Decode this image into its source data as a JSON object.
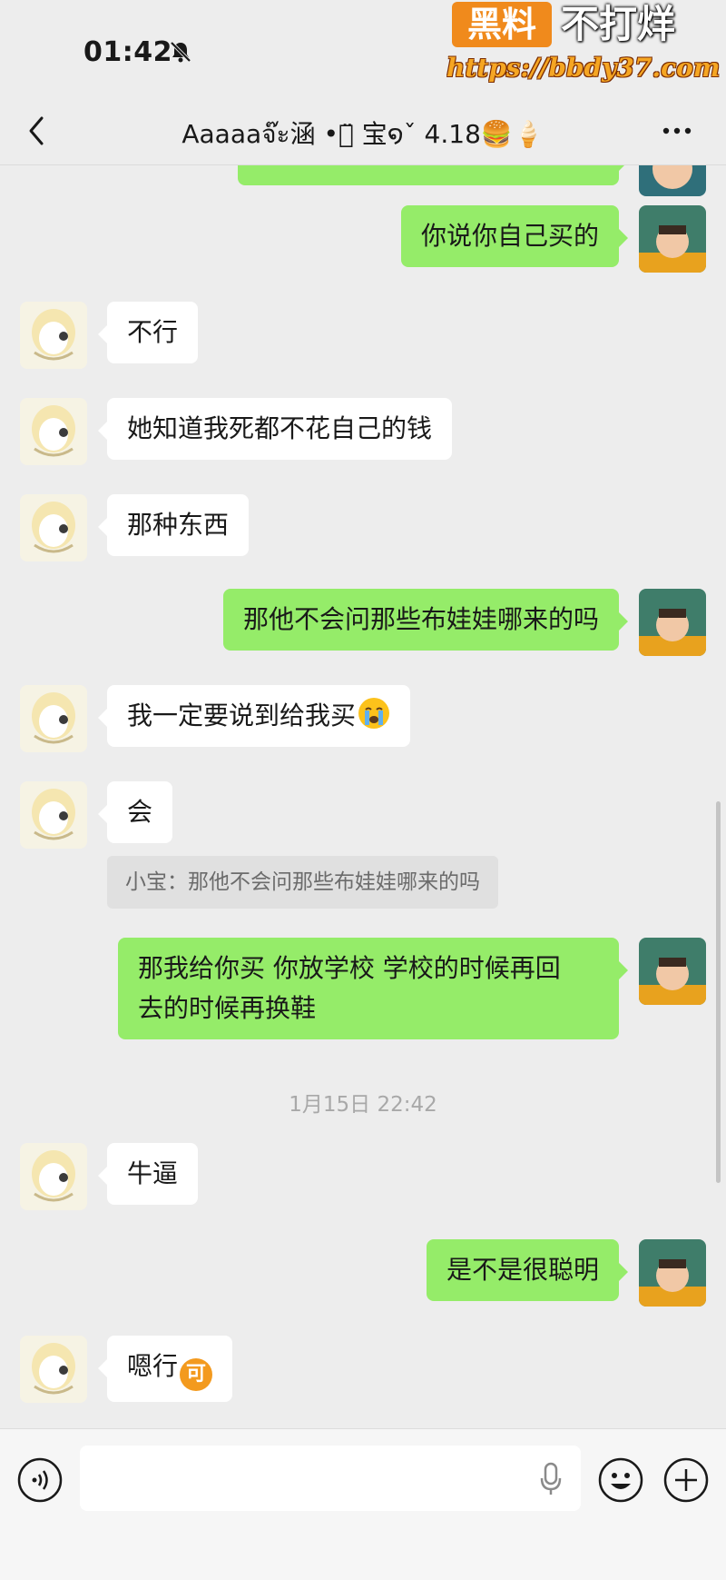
{
  "status_bar": {
    "time": "01:42"
  },
  "watermark": {
    "brand": "黑料",
    "slogan": "不打烊",
    "url": "https://bbdy37.com"
  },
  "nav": {
    "title": "Aaaaaจ๊ะ涵 •ꈊ̈ 宝໑ˇ 4.18🍔🍦"
  },
  "messages": [
    {
      "side": "right",
      "text": "你说你自己买的"
    },
    {
      "side": "left",
      "text": "不行"
    },
    {
      "side": "left",
      "text": "她知道我死都不花自己的钱"
    },
    {
      "side": "left",
      "text": "那种东西"
    },
    {
      "side": "right",
      "text": "那他不会问那些布娃娃哪来的吗"
    },
    {
      "side": "left",
      "text": "我一定要说到给我买",
      "emoji": "crying-face"
    },
    {
      "side": "left",
      "text": "会"
    },
    {
      "quote": "小宝：那他不会问那些布娃娃哪来的吗"
    },
    {
      "side": "right",
      "line1": "那我给你买 你放学校 学校的时候再回",
      "line2": "去的时候再换鞋"
    },
    {
      "timestamp": "1月15日 22:42"
    },
    {
      "side": "left",
      "text": "牛逼"
    },
    {
      "side": "right",
      "text": "是不是很聪明"
    },
    {
      "side": "left",
      "text": "嗯行",
      "emoji": "ke-sticker",
      "emoji_text": "可"
    }
  ],
  "colors": {
    "sent_bubble": "#95ec69",
    "received_bubble": "#ffffff",
    "background": "#ededed",
    "watermark_orange": "#f08a1c"
  },
  "icons": [
    "back-icon",
    "more-icon",
    "voice-icon",
    "microphone-icon",
    "emoji-icon",
    "plus-icon",
    "bell-muted-icon"
  ]
}
